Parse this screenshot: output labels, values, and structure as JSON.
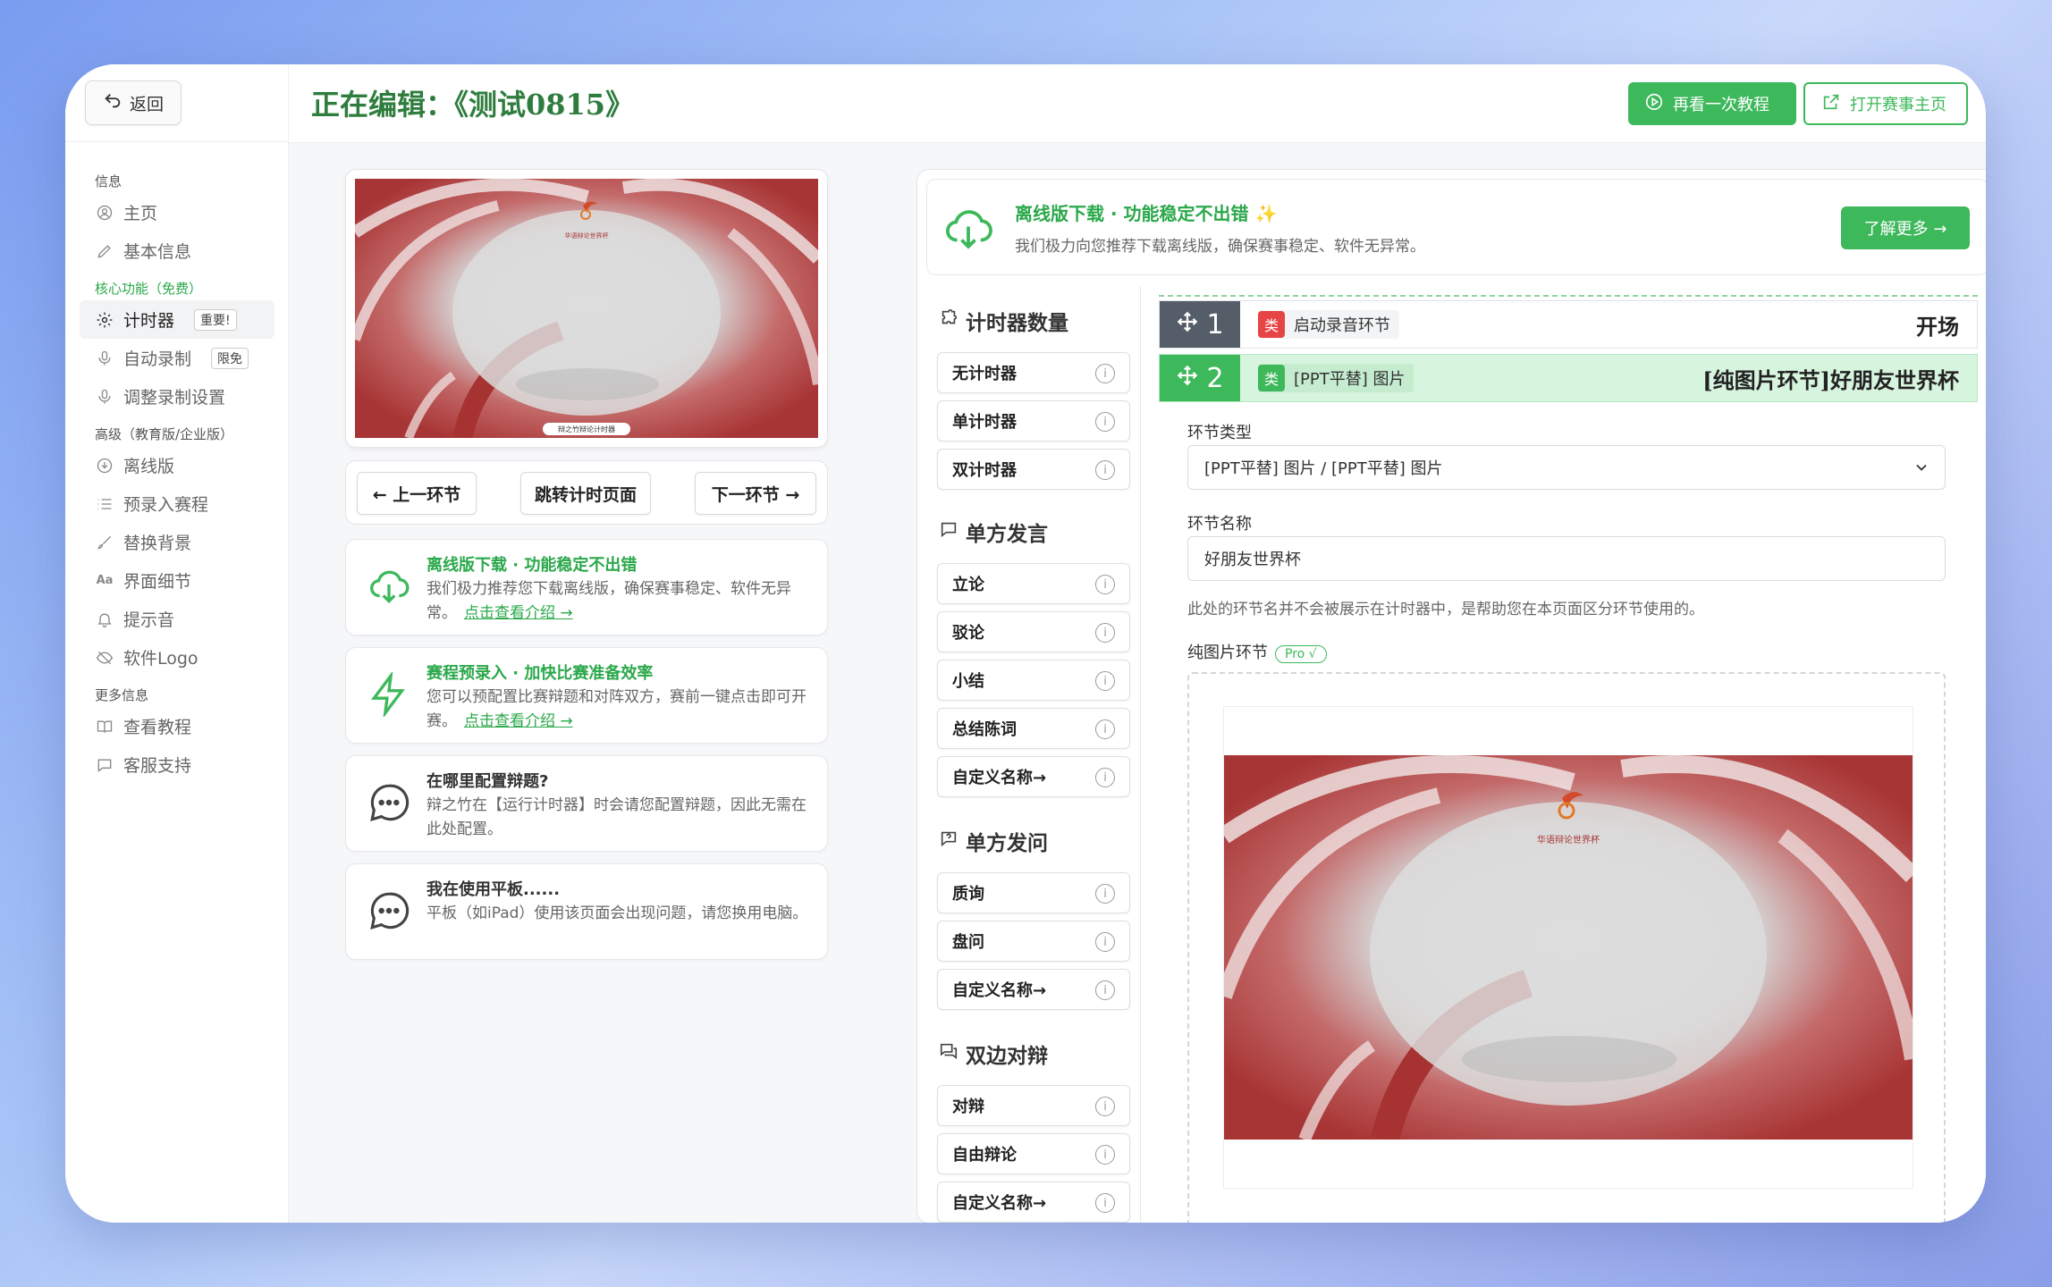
{
  "sidebar": {
    "back_label": "返回",
    "groups": [
      {
        "title": "信息",
        "items": [
          {
            "label": "主页"
          },
          {
            "label": "基本信息"
          }
        ]
      },
      {
        "title": "核心功能（免费）",
        "items": [
          {
            "label": "计时器",
            "tag": "重要!"
          },
          {
            "label": "自动录制",
            "tag": "限免"
          },
          {
            "label": "调整录制设置"
          }
        ]
      },
      {
        "title": "高级（教育版/企业版）",
        "items": [
          {
            "label": "离线版"
          },
          {
            "label": "预录入赛程"
          },
          {
            "label": "替换背景"
          },
          {
            "label": "界面细节"
          },
          {
            "label": "提示音"
          },
          {
            "label": "软件Logo"
          }
        ]
      },
      {
        "title": "更多信息",
        "items": [
          {
            "label": "查看教程"
          },
          {
            "label": "客服支持"
          }
        ]
      }
    ]
  },
  "header": {
    "title": "正在编辑：《测试0815》",
    "tutorial_label": "再看一次教程",
    "home_label": "打开赛事主页"
  },
  "preview": {
    "logo_text": "华语辩论世界杯",
    "caption": "辩之竹辩论计时器"
  },
  "navbar": {
    "prev_label": "← 上一环节",
    "jump_label": "跳转计时页面",
    "next_label": "下一环节 →"
  },
  "info_cards": [
    {
      "title": "离线版下载 · 功能稳定不出错",
      "desc": "我们极力推荐您下载离线版，确保赛事稳定、软件无异常。",
      "link": "点击查看介绍 →"
    },
    {
      "title": "赛程预录入 · 加快比赛准备效率",
      "desc": "您可以预配置比赛辩题和对阵双方，赛前一键点击即可开赛。",
      "link": "点击查看介绍 →"
    },
    {
      "title": "在哪里配置辩题?",
      "desc": "辩之竹在【运行计时器】时会请您配置辩题，因此无需在此处配置。"
    },
    {
      "title": "我在使用平板......",
      "desc": "平板（如iPad）使用该页面会出现问题，请您换用电脑。"
    }
  ],
  "banner": {
    "title": "离线版下载 · 功能稳定不出错 ✨",
    "desc": "我们极力向您推荐下载离线版，确保赛事稳定、软件无异常。",
    "more_label": "了解更多 →"
  },
  "tools": {
    "sections": [
      {
        "title": "计时器数量",
        "items": [
          "无计时器",
          "单计时器",
          "双计时器"
        ]
      },
      {
        "title": "单方发言",
        "items": [
          "立论",
          "驳论",
          "小结",
          "总结陈词",
          "自定义名称→"
        ]
      },
      {
        "title": "单方发问",
        "items": [
          "质询",
          "盘问",
          "自定义名称→"
        ]
      },
      {
        "title": "双边对辩",
        "items": [
          "对辩",
          "自由辩论",
          "自定义名称→"
        ]
      }
    ],
    "info_glyph": "i"
  },
  "flow": {
    "segments": [
      {
        "num": "1",
        "cat_key": "类",
        "cat": "启动录音环节",
        "name": "开场"
      },
      {
        "num": "2",
        "cat_key": "类",
        "cat": "[PPT平替] 图片",
        "name": "[纯图片环节]好朋友世界杯"
      }
    ],
    "type_label": "环节类型",
    "type_value": "[PPT平替] 图片 / [PPT平替] 图片",
    "name_label": "环节名称",
    "name_value": "好朋友世界杯",
    "helper": "此处的环节名并不会被展示在计时器中，是帮助您在本页面区分环节使用的。",
    "image_label": "纯图片环节",
    "pro_badge": "Pro √",
    "image_logo_text": "华语辩论世界杯"
  },
  "colors": {
    "accent": "#3db85b",
    "title_green": "#2f7d3e",
    "tag_red": "#e64545"
  }
}
